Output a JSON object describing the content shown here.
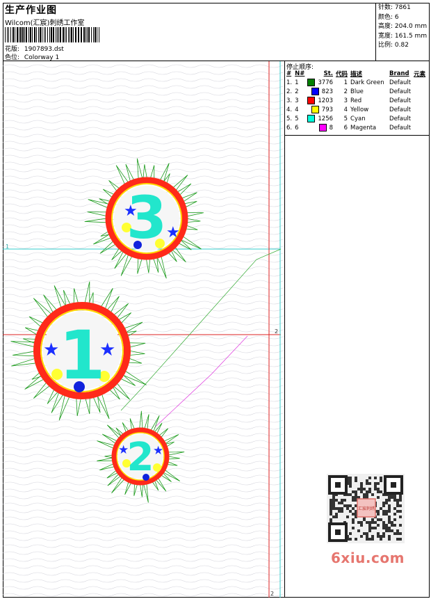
{
  "header": {
    "title": "生产作业图",
    "company": "Wilcom(汇宸)刺绣工作室",
    "design_label": "花版:",
    "design_file": "1907893.dst",
    "colorway_label": "色位:",
    "colorway": "Colorway 1"
  },
  "stats": [
    {
      "label": "针数:",
      "value": "7861"
    },
    {
      "label": "颜色:",
      "value": "6"
    },
    {
      "label": "高度:",
      "value": "204.0 mm"
    },
    {
      "label": "宽度:",
      "value": "161.5 mm"
    },
    {
      "label": "比例:",
      "value": "0.82"
    }
  ],
  "stops": {
    "title": "停止顺序:",
    "columns": [
      "#",
      "N#",
      "St.",
      "代码",
      "描述",
      "Brand",
      "元素"
    ],
    "rows": [
      {
        "num": "1.",
        "n": "1",
        "st": "3776",
        "code": "1",
        "desc": "Dark Green",
        "brand": "Default",
        "color": "#008000"
      },
      {
        "num": "2.",
        "n": "2",
        "st": "823",
        "code": "2",
        "desc": "Blue",
        "brand": "Default",
        "color": "#0000ff"
      },
      {
        "num": "3.",
        "n": "3",
        "st": "1203",
        "code": "3",
        "desc": "Red",
        "brand": "Default",
        "color": "#ff0000"
      },
      {
        "num": "4.",
        "n": "4",
        "st": "793",
        "code": "4",
        "desc": "Yellow",
        "brand": "Default",
        "color": "#ffff00"
      },
      {
        "num": "5.",
        "n": "5",
        "st": "1256",
        "code": "5",
        "desc": "Cyan",
        "brand": "Default",
        "color": "#00ffdd"
      },
      {
        "num": "6.",
        "n": "6",
        "st": "8",
        "code": "6",
        "desc": "Magenta",
        "brand": "Default",
        "color": "#ff00ff"
      }
    ]
  },
  "design": {
    "guide_label_1": "1",
    "guide_label_2a": "2",
    "guide_label_2b": "2",
    "badge_numbers": [
      "3",
      "1",
      "2"
    ]
  },
  "watermark": {
    "seal": "汇宸刺绣",
    "site": "6xiu.com"
  }
}
